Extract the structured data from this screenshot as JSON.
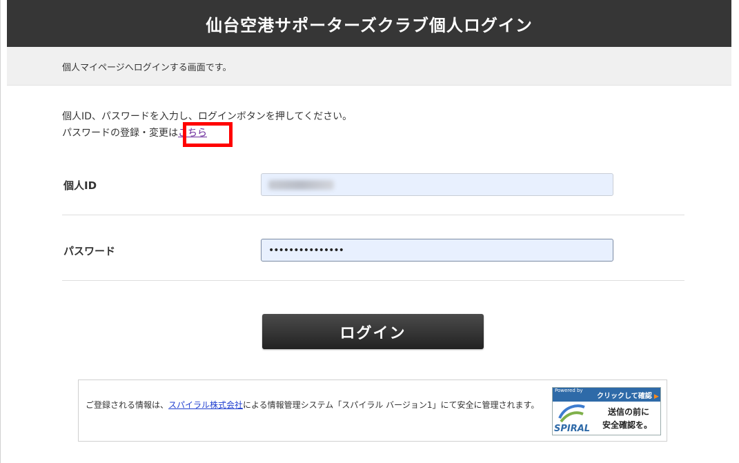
{
  "header": {
    "title": "仙台空港サポーターズクラブ個人ログイン"
  },
  "subbar": {
    "text": "個人マイページへログインする画面です。"
  },
  "instructions": {
    "line1": "個人ID、パスワードを入力し、ログインボタンを押してください。",
    "line2_prefix": "パスワードの登録・変更は",
    "line2_link": "こちら"
  },
  "form": {
    "id_label": "個人ID",
    "password_label": "パスワード",
    "password_value": "•••••••••••••••"
  },
  "login_button": {
    "label": "ログイン"
  },
  "notice": {
    "prefix": "ご登録される情報は、",
    "company_link": "スパイラル株式会社",
    "suffix": "による情報管理システム「スパイラル バージョン1」にて安全に管理されます。"
  },
  "badge": {
    "powered": "Powered by",
    "click_confirm": "クリックして確認",
    "brand": "SPIRAL",
    "text1": "送信の前に",
    "text2": "安全確認を。"
  },
  "colors": {
    "header_bg": "#363636",
    "highlight": "#ff0000",
    "link": "#1f3ecf"
  }
}
